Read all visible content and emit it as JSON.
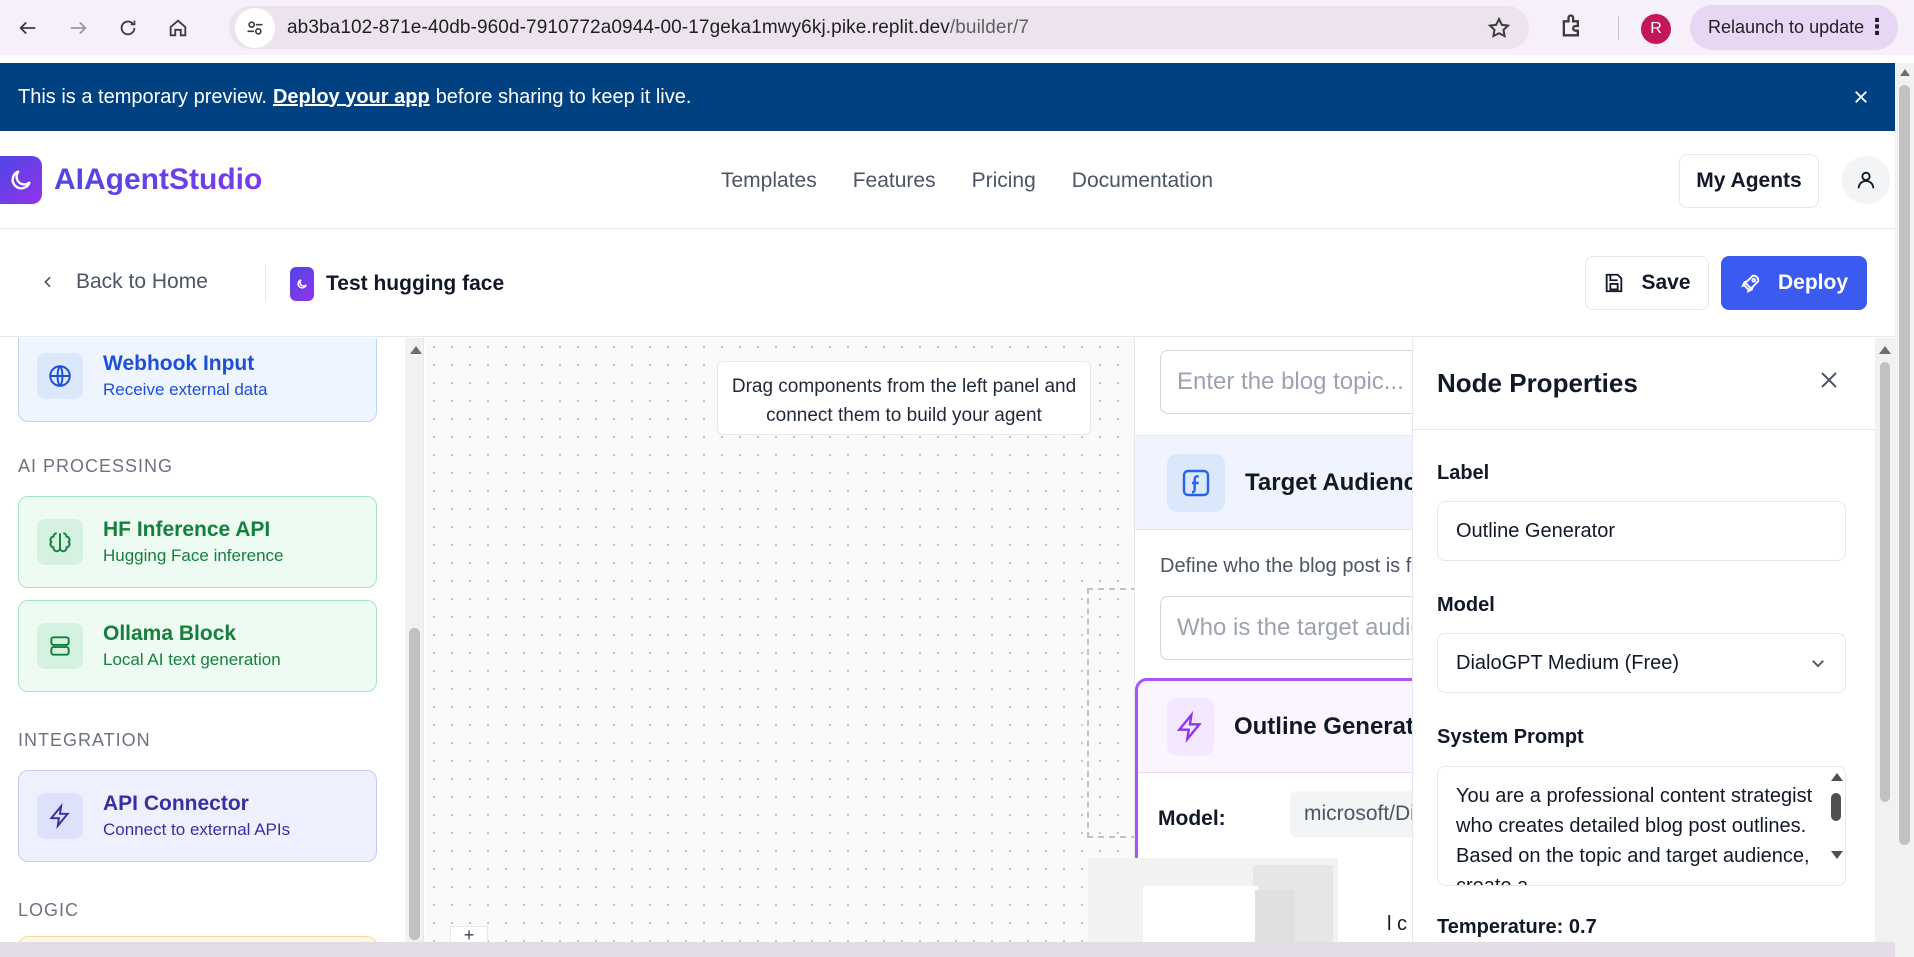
{
  "browser": {
    "url_host": "ab3ba102-871e-40db-960d-7910772a0944-00-17geka1mwy6kj.pike.replit.dev",
    "url_path": "/builder/7",
    "profile_initial": "R",
    "relaunch_label": "Relaunch to update"
  },
  "banner": {
    "text_before": "This is a temporary preview.",
    "link": "Deploy your app",
    "text_after": "before sharing to keep it live."
  },
  "header": {
    "brand": "AIAgentStudio",
    "nav": [
      "Templates",
      "Features",
      "Pricing",
      "Documentation"
    ],
    "my_agents": "My Agents"
  },
  "toolbar": {
    "back_label": "Back to Home",
    "agent_name": "Test hugging face",
    "save_label": "Save",
    "deploy_label": "Deploy"
  },
  "left_panel": {
    "webhook": {
      "title": "Webhook Input",
      "subtitle": "Receive external data"
    },
    "section_ai": "AI PROCESSING",
    "hf": {
      "title": "HF Inference API",
      "subtitle": "Hugging Face inference"
    },
    "ollama": {
      "title": "Ollama Block",
      "subtitle": "Local AI text generation"
    },
    "section_integration": "INTEGRATION",
    "api": {
      "title": "API Connector",
      "subtitle": "Connect to external APIs"
    },
    "section_logic": "LOGIC"
  },
  "canvas": {
    "hint": "Drag components from the left panel and connect them to build your agent",
    "topic_placeholder": "Enter the blog topic...",
    "audience_title": "Target Audience",
    "audience_desc": "Define who the blog post is for",
    "audience_placeholder": "Who is the target audience?",
    "outline_title": "Outline Generator",
    "model_label": "Model:",
    "model_value": "microsoft/DialoGPT-medium",
    "partial_text": "l c"
  },
  "properties": {
    "title": "Node Properties",
    "label_label": "Label",
    "label_value": "Outline Generator",
    "model_label": "Model",
    "model_value": "DialoGPT Medium (Free)",
    "prompt_label": "System Prompt",
    "prompt_value": "You are a professional content strategist who creates detailed blog post outlines. Based on the topic and target audience, create a",
    "temperature_label": "Temperature: 0.7"
  },
  "colors": {
    "banner": "#004182",
    "deploy": "#3b5bf0",
    "brand_start": "#4f46e5",
    "brand_end": "#9333ea"
  }
}
